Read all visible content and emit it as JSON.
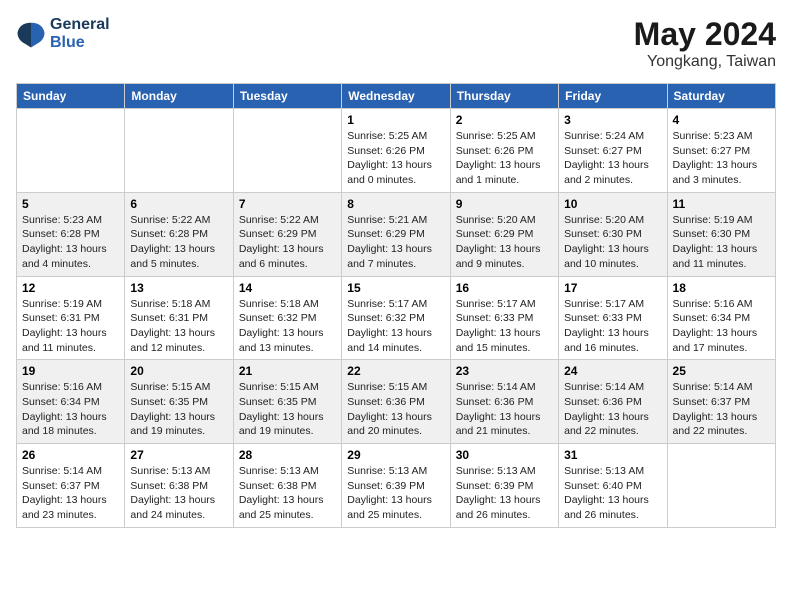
{
  "header": {
    "logo_line1": "General",
    "logo_line2": "Blue",
    "month_year": "May 2024",
    "location": "Yongkang, Taiwan"
  },
  "weekdays": [
    "Sunday",
    "Monday",
    "Tuesday",
    "Wednesday",
    "Thursday",
    "Friday",
    "Saturday"
  ],
  "weeks": [
    {
      "shaded": false,
      "days": [
        {
          "num": "",
          "info": ""
        },
        {
          "num": "",
          "info": ""
        },
        {
          "num": "",
          "info": ""
        },
        {
          "num": "1",
          "info": "Sunrise: 5:25 AM\nSunset: 6:26 PM\nDaylight: 13 hours\nand 0 minutes."
        },
        {
          "num": "2",
          "info": "Sunrise: 5:25 AM\nSunset: 6:26 PM\nDaylight: 13 hours\nand 1 minute."
        },
        {
          "num": "3",
          "info": "Sunrise: 5:24 AM\nSunset: 6:27 PM\nDaylight: 13 hours\nand 2 minutes."
        },
        {
          "num": "4",
          "info": "Sunrise: 5:23 AM\nSunset: 6:27 PM\nDaylight: 13 hours\nand 3 minutes."
        }
      ]
    },
    {
      "shaded": true,
      "days": [
        {
          "num": "5",
          "info": "Sunrise: 5:23 AM\nSunset: 6:28 PM\nDaylight: 13 hours\nand 4 minutes."
        },
        {
          "num": "6",
          "info": "Sunrise: 5:22 AM\nSunset: 6:28 PM\nDaylight: 13 hours\nand 5 minutes."
        },
        {
          "num": "7",
          "info": "Sunrise: 5:22 AM\nSunset: 6:29 PM\nDaylight: 13 hours\nand 6 minutes."
        },
        {
          "num": "8",
          "info": "Sunrise: 5:21 AM\nSunset: 6:29 PM\nDaylight: 13 hours\nand 7 minutes."
        },
        {
          "num": "9",
          "info": "Sunrise: 5:20 AM\nSunset: 6:29 PM\nDaylight: 13 hours\nand 9 minutes."
        },
        {
          "num": "10",
          "info": "Sunrise: 5:20 AM\nSunset: 6:30 PM\nDaylight: 13 hours\nand 10 minutes."
        },
        {
          "num": "11",
          "info": "Sunrise: 5:19 AM\nSunset: 6:30 PM\nDaylight: 13 hours\nand 11 minutes."
        }
      ]
    },
    {
      "shaded": false,
      "days": [
        {
          "num": "12",
          "info": "Sunrise: 5:19 AM\nSunset: 6:31 PM\nDaylight: 13 hours\nand 11 minutes."
        },
        {
          "num": "13",
          "info": "Sunrise: 5:18 AM\nSunset: 6:31 PM\nDaylight: 13 hours\nand 12 minutes."
        },
        {
          "num": "14",
          "info": "Sunrise: 5:18 AM\nSunset: 6:32 PM\nDaylight: 13 hours\nand 13 minutes."
        },
        {
          "num": "15",
          "info": "Sunrise: 5:17 AM\nSunset: 6:32 PM\nDaylight: 13 hours\nand 14 minutes."
        },
        {
          "num": "16",
          "info": "Sunrise: 5:17 AM\nSunset: 6:33 PM\nDaylight: 13 hours\nand 15 minutes."
        },
        {
          "num": "17",
          "info": "Sunrise: 5:17 AM\nSunset: 6:33 PM\nDaylight: 13 hours\nand 16 minutes."
        },
        {
          "num": "18",
          "info": "Sunrise: 5:16 AM\nSunset: 6:34 PM\nDaylight: 13 hours\nand 17 minutes."
        }
      ]
    },
    {
      "shaded": true,
      "days": [
        {
          "num": "19",
          "info": "Sunrise: 5:16 AM\nSunset: 6:34 PM\nDaylight: 13 hours\nand 18 minutes."
        },
        {
          "num": "20",
          "info": "Sunrise: 5:15 AM\nSunset: 6:35 PM\nDaylight: 13 hours\nand 19 minutes."
        },
        {
          "num": "21",
          "info": "Sunrise: 5:15 AM\nSunset: 6:35 PM\nDaylight: 13 hours\nand 19 minutes."
        },
        {
          "num": "22",
          "info": "Sunrise: 5:15 AM\nSunset: 6:36 PM\nDaylight: 13 hours\nand 20 minutes."
        },
        {
          "num": "23",
          "info": "Sunrise: 5:14 AM\nSunset: 6:36 PM\nDaylight: 13 hours\nand 21 minutes."
        },
        {
          "num": "24",
          "info": "Sunrise: 5:14 AM\nSunset: 6:36 PM\nDaylight: 13 hours\nand 22 minutes."
        },
        {
          "num": "25",
          "info": "Sunrise: 5:14 AM\nSunset: 6:37 PM\nDaylight: 13 hours\nand 22 minutes."
        }
      ]
    },
    {
      "shaded": false,
      "days": [
        {
          "num": "26",
          "info": "Sunrise: 5:14 AM\nSunset: 6:37 PM\nDaylight: 13 hours\nand 23 minutes."
        },
        {
          "num": "27",
          "info": "Sunrise: 5:13 AM\nSunset: 6:38 PM\nDaylight: 13 hours\nand 24 minutes."
        },
        {
          "num": "28",
          "info": "Sunrise: 5:13 AM\nSunset: 6:38 PM\nDaylight: 13 hours\nand 25 minutes."
        },
        {
          "num": "29",
          "info": "Sunrise: 5:13 AM\nSunset: 6:39 PM\nDaylight: 13 hours\nand 25 minutes."
        },
        {
          "num": "30",
          "info": "Sunrise: 5:13 AM\nSunset: 6:39 PM\nDaylight: 13 hours\nand 26 minutes."
        },
        {
          "num": "31",
          "info": "Sunrise: 5:13 AM\nSunset: 6:40 PM\nDaylight: 13 hours\nand 26 minutes."
        },
        {
          "num": "",
          "info": ""
        }
      ]
    }
  ]
}
